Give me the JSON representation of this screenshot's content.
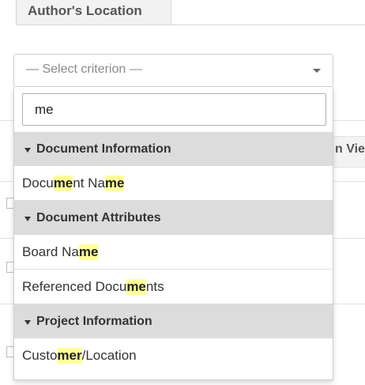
{
  "tab": {
    "label": "Author's Location"
  },
  "background": {
    "column_header_fragment": "n Vie"
  },
  "select": {
    "placeholder": "— Select criterion —"
  },
  "search": {
    "value": "me"
  },
  "highlight_color": "#ffff99",
  "groups": [
    {
      "label": "Document Information",
      "options": [
        {
          "parts": [
            {
              "text": "Docu",
              "hl": false
            },
            {
              "text": "me",
              "hl": true
            },
            {
              "text": "nt Na",
              "hl": false
            },
            {
              "text": "me",
              "hl": true
            }
          ]
        }
      ]
    },
    {
      "label": "Document Attributes",
      "options": [
        {
          "parts": [
            {
              "text": "Board Na",
              "hl": false
            },
            {
              "text": "me",
              "hl": true
            }
          ]
        },
        {
          "parts": [
            {
              "text": "Referenced Docu",
              "hl": false
            },
            {
              "text": "me",
              "hl": true
            },
            {
              "text": "nts",
              "hl": false
            }
          ]
        }
      ]
    },
    {
      "label": "Project Information",
      "options": [
        {
          "parts": [
            {
              "text": "Custo",
              "hl": false
            },
            {
              "text": "mer",
              "hl": true
            },
            {
              "text": "/Location",
              "hl": false
            }
          ]
        }
      ]
    }
  ]
}
